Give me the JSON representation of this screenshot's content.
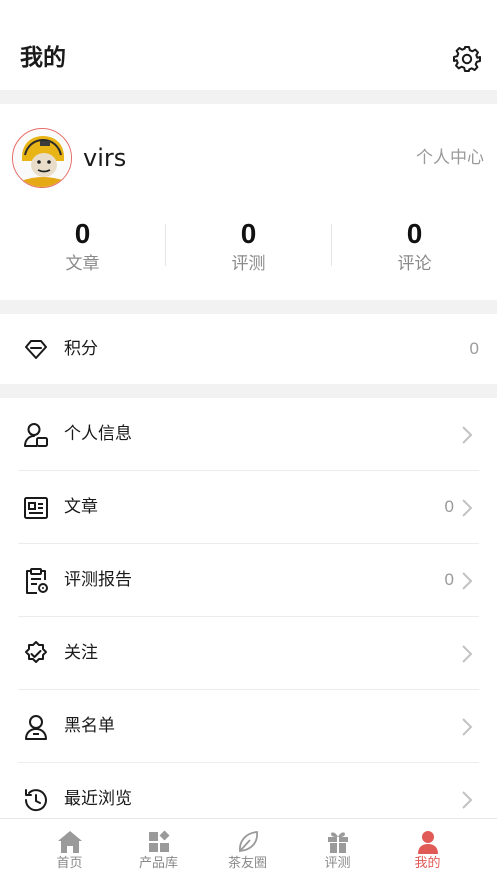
{
  "header": {
    "title": "我的"
  },
  "profile": {
    "username": "virs",
    "center_link": "个人中心",
    "stats": [
      {
        "value": "0",
        "label": "文章"
      },
      {
        "value": "0",
        "label": "评测"
      },
      {
        "value": "0",
        "label": "评论"
      }
    ]
  },
  "points": {
    "label": "积分",
    "value": "0"
  },
  "menu": [
    {
      "label": "个人信息",
      "icon": "user-card-icon"
    },
    {
      "label": "文章",
      "count": "0",
      "icon": "article-icon"
    },
    {
      "label": "评测报告",
      "count": "0",
      "icon": "report-icon"
    },
    {
      "label": "关注",
      "icon": "badge-check-icon"
    },
    {
      "label": "黑名单",
      "icon": "user-block-icon"
    },
    {
      "label": "最近浏览",
      "icon": "history-icon"
    }
  ],
  "tabs": [
    {
      "label": "首页",
      "icon": "home-icon"
    },
    {
      "label": "产品库",
      "icon": "grid-icon"
    },
    {
      "label": "茶友圈",
      "icon": "leaf-icon"
    },
    {
      "label": "评测",
      "icon": "gift-icon"
    },
    {
      "label": "我的",
      "icon": "person-icon",
      "active": true
    }
  ],
  "colors": {
    "accent": "#e05a56",
    "inactive": "#8a8a8a",
    "background": "#f2f2f2"
  }
}
